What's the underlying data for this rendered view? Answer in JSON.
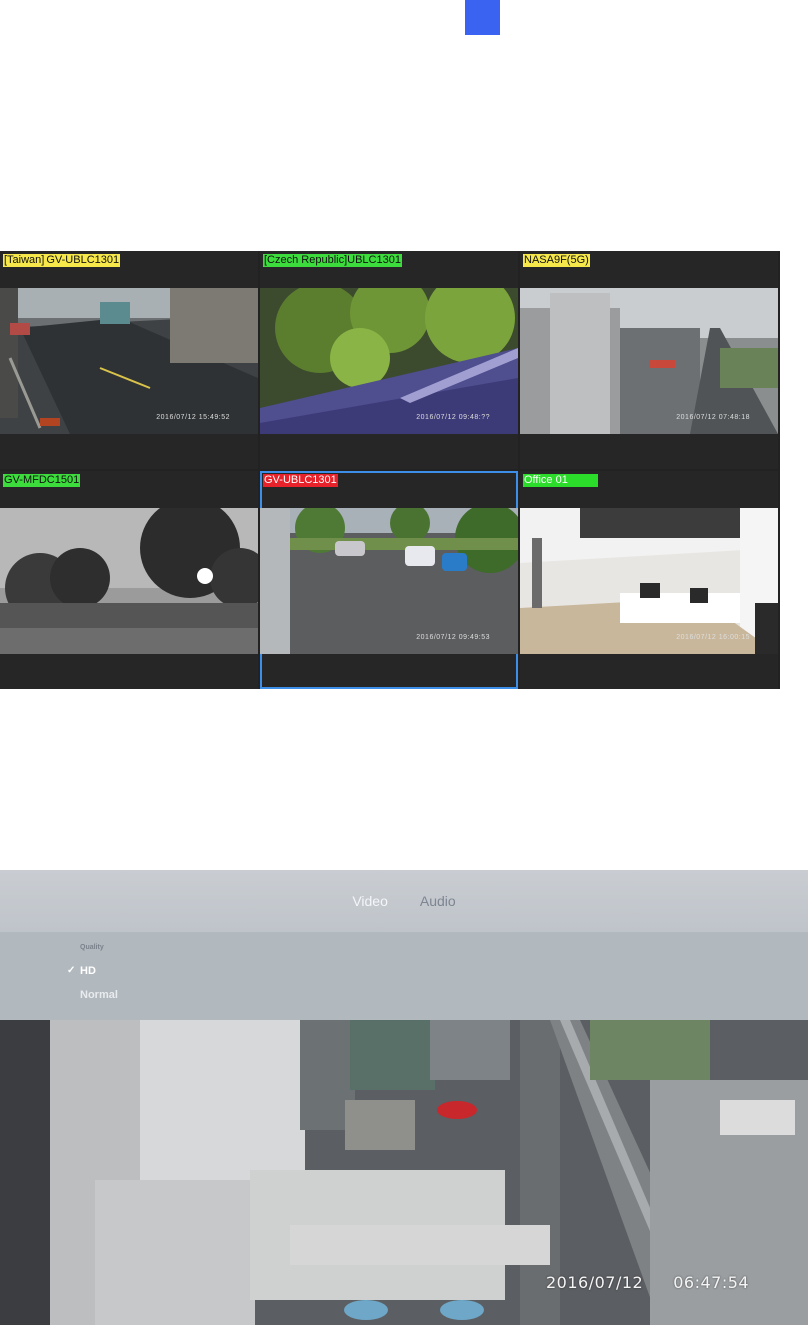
{
  "cameras": [
    {
      "segments": [
        {
          "text": "[Taiwan]",
          "color": "#f6e84a"
        },
        {
          "text": "GV-UBLC1301",
          "color": "#f6e84a"
        }
      ],
      "timestamp": "2016/07/12   15:49:52",
      "selected": false
    },
    {
      "segments": [
        {
          "text": "[Czech Republic]UBLC1301",
          "color": "#3ddc3d"
        }
      ],
      "timestamp": "2016/07/12   09:48:??",
      "selected": false
    },
    {
      "segments": [
        {
          "text": "NASA9F(5G)",
          "color": "#f6e84a"
        }
      ],
      "timestamp": "2016/07/12   07:48:18",
      "selected": false
    },
    {
      "segments": [
        {
          "text": "GV-MFDC1501",
          "color": "#3ddc3d"
        }
      ],
      "timestamp": "",
      "selected": false
    },
    {
      "segments": [
        {
          "text": "GV-UBLC1301",
          "color": "#e8222b"
        }
      ],
      "timestamp": "2016/07/12   09:49:53",
      "selected": true
    },
    {
      "segments": [
        {
          "text": "Office 01",
          "color": "#2bdc2b"
        }
      ],
      "timestamp": "2016/07/12   16:00:15",
      "selected": false
    }
  ],
  "player": {
    "tabs": [
      {
        "label": "Video",
        "active": true
      },
      {
        "label": "Audio",
        "active": false
      }
    ],
    "quality": {
      "title": "Quality",
      "options": [
        {
          "label": "HD",
          "selected": true
        },
        {
          "label": "Normal",
          "selected": false
        }
      ]
    },
    "date": "2016/07/12",
    "time": "06:47:54"
  },
  "colors": {
    "accent_marker": "#3a63f2",
    "selection_outline": "#3d8ee8"
  }
}
